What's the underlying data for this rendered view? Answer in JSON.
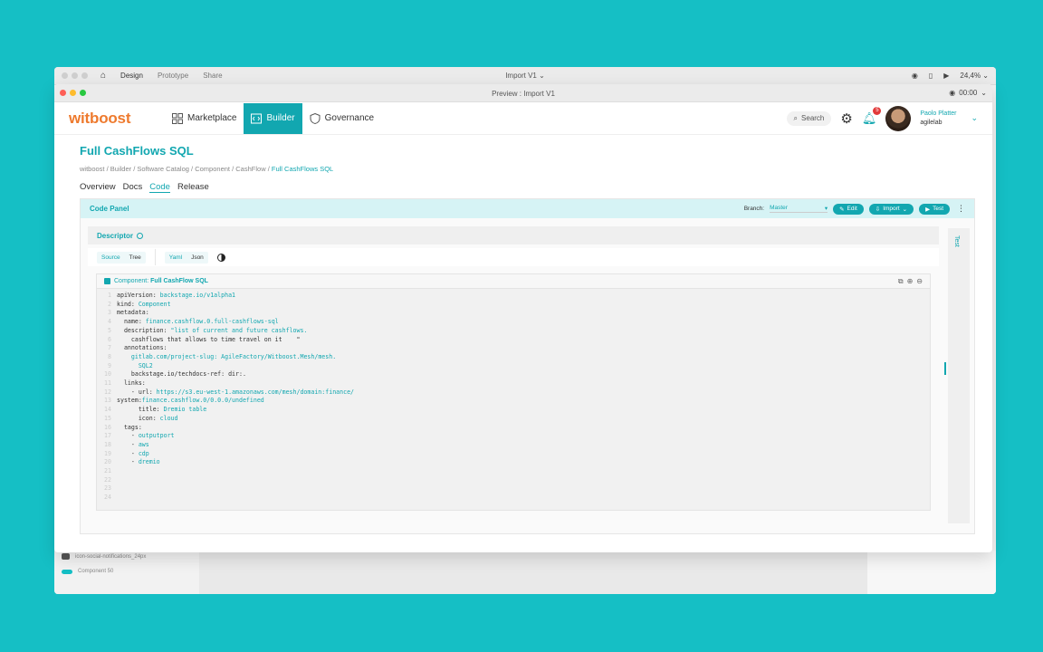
{
  "design_app": {
    "nav": {
      "design": "Design",
      "prototype": "Prototype",
      "share": "Share"
    },
    "title": "Import V1",
    "zoom": "24,4%",
    "layers": [
      {
        "name": "icon-social-notifications_24px"
      },
      {
        "name": "Component 50"
      }
    ]
  },
  "preview": {
    "title": "Preview : Import V1",
    "time": "00:00"
  },
  "header": {
    "logo": "witboost",
    "nav": [
      {
        "label": "Marketplace",
        "icon": "grid-icon"
      },
      {
        "label": "Builder",
        "icon": "code-icon"
      },
      {
        "label": "Governance",
        "icon": "shield-icon"
      }
    ],
    "search_placeholder": "Search",
    "notifications_count": "5",
    "user": {
      "name": "Paolo Platter",
      "org": "agilelab"
    }
  },
  "page": {
    "title": "Full CashFlows SQL",
    "breadcrumb": [
      "witboost",
      "Builder",
      "Software Catalog",
      "Component",
      "CashFlow"
    ],
    "breadcrumb_current": "Full CashFlows SQL",
    "tabs": [
      "Overview",
      "Docs",
      "Code",
      "Release"
    ]
  },
  "code_panel": {
    "title": "Code Panel",
    "branch_label": "Branch:",
    "branch_value": "Master",
    "edit_label": "Edit",
    "import_label": "Import",
    "test_label": "Test",
    "descriptor_label": "Descriptor",
    "side_test_label": "Test",
    "source_label": "Source",
    "tree_label": "Tree",
    "yaml_label": "Yaml",
    "json_label": "Json",
    "component_label": "Component:",
    "component_name": "Full CashFlow SQL"
  },
  "code_lines": [
    {
      "n": "1",
      "k": "apiVersion: ",
      "v": "backstage.io/v1alpha1"
    },
    {
      "n": "2",
      "k": "kind: ",
      "v": "Component"
    },
    {
      "n": "3",
      "k": "metadata:",
      "v": ""
    },
    {
      "n": "4",
      "k": "  name: ",
      "v": "finance.cashflow.0.full-cashflows-sql"
    },
    {
      "n": "5",
      "k": "  description: ",
      "v": "\"list of current and future cashflows."
    },
    {
      "n": "6",
      "k": "    cashflows that allows to time travel on it    \"",
      "v": ""
    },
    {
      "n": "7",
      "k": "  annotations:",
      "v": ""
    },
    {
      "n": "8",
      "k": "    ",
      "v": "gitlab.com/project-slug: AgileFactory/Witboost.Mesh/mesh."
    },
    {
      "n": "9",
      "k": "      ",
      "v": "SQL2"
    },
    {
      "n": "10",
      "k": "    backstage.io/techdocs-ref: dir:.",
      "v": ""
    },
    {
      "n": "11",
      "k": "  links:",
      "v": ""
    },
    {
      "n": "12",
      "k": "    - url: ",
      "v": "https://s3.eu-west-1.amazonaws.com/mesh/domain:finance/"
    },
    {
      "n": "13",
      "k": "system:",
      "v": "finance.cashflow.0/0.0.0/undefined"
    },
    {
      "n": "14",
      "k": "      title: ",
      "v": "Dremio table"
    },
    {
      "n": "15",
      "k": "      icon: ",
      "v": "cloud"
    },
    {
      "n": "16",
      "k": "  tags:",
      "v": ""
    },
    {
      "n": "17",
      "k": "    - ",
      "v": "outputport"
    },
    {
      "n": "18",
      "k": "    - ",
      "v": "aws"
    },
    {
      "n": "19",
      "k": "    - ",
      "v": "cdp"
    },
    {
      "n": "20",
      "k": "    - ",
      "v": "dremio"
    },
    {
      "n": "21",
      "k": "",
      "v": ""
    },
    {
      "n": "22",
      "k": "",
      "v": ""
    },
    {
      "n": "23",
      "k": "",
      "v": ""
    },
    {
      "n": "24",
      "k": "",
      "v": ""
    }
  ]
}
